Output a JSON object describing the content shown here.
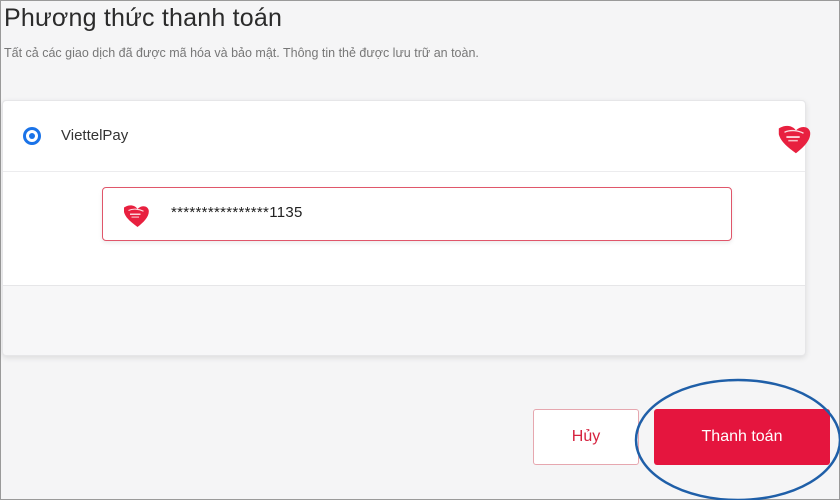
{
  "header": {
    "title": "Phương thức thanh toán",
    "subtitle": "Tất cả các giao dịch đã được mã hóa và bảo mật. Thông tin thẻ được lưu trữ an toàn."
  },
  "payment_method": {
    "selected": true,
    "label": "ViettelPay",
    "logo_icon": "viettelpay-logo-icon",
    "account_masked": "****************1135"
  },
  "actions": {
    "cancel_label": "Hủy",
    "pay_label": "Thanh toán"
  },
  "colors": {
    "accent_red": "#e5153e",
    "radio_blue": "#1a73e8",
    "annotation_ring": "#1f5fa8"
  }
}
